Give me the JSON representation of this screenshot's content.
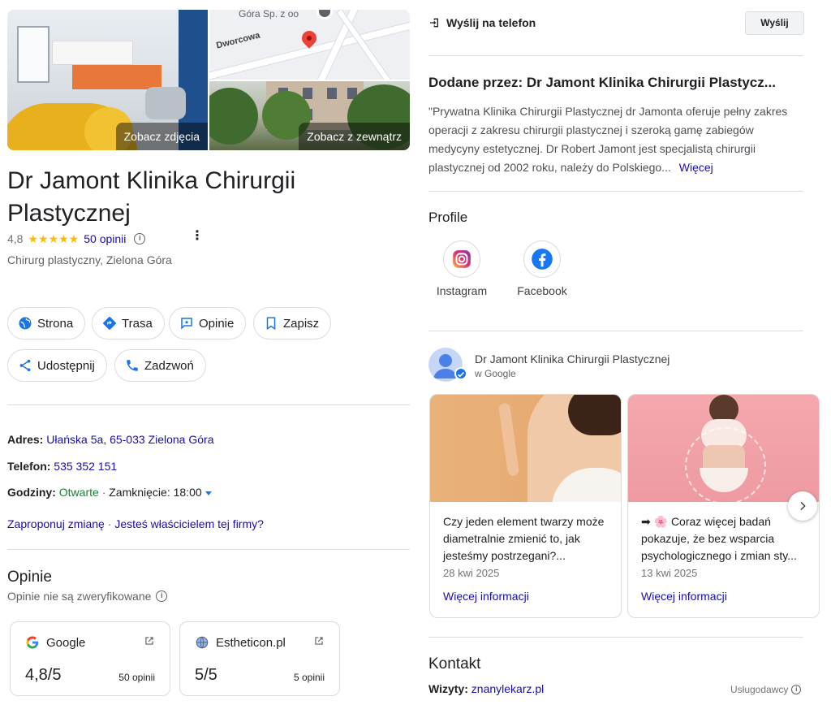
{
  "media": {
    "photos_label": "Zobacz zdjęcia",
    "outside_label": "Zobacz z zewnątrz",
    "map_labels": {
      "company": "Góra Sp. z oo",
      "street": "Dworcowa"
    }
  },
  "business": {
    "name": "Dr Jamont Klinika Chirurgii Plastycznej",
    "rating": "4,8",
    "stars": "★★★★★",
    "reviews": "50 opinii",
    "category": "Chirurg plastyczny, Zielona Góra"
  },
  "actions": [
    {
      "label": "Strona",
      "icon": "globe-icon"
    },
    {
      "label": "Trasa",
      "icon": "directions-icon"
    },
    {
      "label": "Opinie",
      "icon": "review-icon"
    },
    {
      "label": "Zapisz",
      "icon": "bookmark-icon"
    },
    {
      "label": "Udostępnij",
      "icon": "share-icon"
    },
    {
      "label": "Zadzwoń",
      "icon": "phone-icon"
    }
  ],
  "details": {
    "address_label": "Adres:",
    "address": "Ułańska 5a, 65-033 Zielona Góra",
    "phone_label": "Telefon:",
    "phone": "535 352 151",
    "hours_label": "Godziny:",
    "open_status": "Otwarte",
    "separator": "·",
    "closing": "Zamknięcie: 18:00",
    "suggest_edit": "Zaproponuj zmianę",
    "own_business": "Jesteś właścicielem tej firmy?"
  },
  "reviews_section": {
    "title": "Opinie",
    "subtitle": "Opinie nie są zweryfikowane",
    "sources": [
      {
        "name": "Google",
        "score": "4,8/5",
        "count": "50 opinii"
      },
      {
        "name": "Estheticon.pl",
        "score": "5/5",
        "count": "5 opinii"
      }
    ]
  },
  "send": {
    "label": "Wyślij na telefon",
    "button": "Wyślij"
  },
  "added_by": {
    "title": "Dodane przez: Dr Jamont Klinika Chirurgii Plastycz...",
    "text": "\"Prywatna Klinika Chirurgii Plastycznej dr Jamonta oferuje pełny zakres operacji z zakresu chirurgii plastycznej i szeroką gamę zabiegów medycyny estetycznej. Dr Robert Jamont jest specjalistą chirurgii plastycznej od 2002 roku, należy do Polskiego...",
    "more": "Więcej"
  },
  "profiles": {
    "title": "Profile",
    "items": [
      {
        "label": "Instagram"
      },
      {
        "label": "Facebook"
      }
    ]
  },
  "posts_header": {
    "name": "Dr Jamont Klinika Chirurgii Plastycznej",
    "sub": "w Google"
  },
  "posts": [
    {
      "text": "Czy jeden element twarzy może diametralnie zmienić to, jak jesteśmy postrzegani?...",
      "date": "28 kwi 2025",
      "more": "Więcej informacji"
    },
    {
      "text": "➡ 🌸 Coraz więcej badań pokazuje, że bez wsparcia psychologicznego i zmian sty...",
      "date": "13 kwi 2025",
      "more": "Więcej informacji"
    }
  ],
  "contact": {
    "title": "Kontakt",
    "visits_label": "Wizyty:",
    "visits_link": "znanylekarz.pl",
    "providers": "Usługodawcy"
  },
  "colors": {
    "link": "#1a0dab",
    "open": "#188038",
    "star": "#fbbc04",
    "divider": "#dadce0"
  }
}
